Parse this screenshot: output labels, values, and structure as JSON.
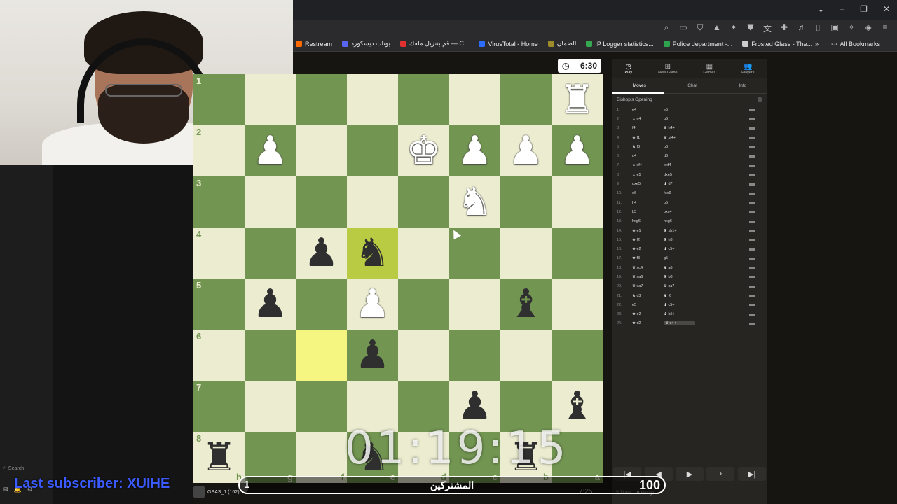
{
  "bookmarks": [
    {
      "label": "Restream",
      "color": "#ff6a00"
    },
    {
      "label": "بوتات ديسكورد",
      "color": "#5865f2"
    },
    {
      "label": "قم بتنزيل ملفك — C...",
      "color": "#e03030"
    },
    {
      "label": "VirusTotal - Home",
      "color": "#2c6cff"
    },
    {
      "label": "الضمان",
      "color": "#9e8c2a"
    },
    {
      "label": "IP Logger statistics...",
      "color": "#36a852"
    },
    {
      "label": "Police department -...",
      "color": "#2ea44f"
    },
    {
      "label": "Frosted Glass - The...",
      "color": "#cccccc"
    }
  ],
  "all_bookmarks": "All Bookmarks",
  "clock_top": "6:30",
  "clock_bottom": "7:25",
  "board": {
    "ranks": [
      "1",
      "2",
      "3",
      "4",
      "5",
      "6",
      "7",
      "8"
    ],
    "files": [
      "h",
      "g",
      "f",
      "e",
      "d",
      "c",
      "b",
      "a"
    ],
    "squares": [
      [
        "",
        "",
        "",
        "",
        "",
        "",
        "",
        "R"
      ],
      [
        "",
        "P",
        "",
        "",
        "K",
        "P",
        "P",
        "P"
      ],
      [
        "",
        "",
        "",
        "",
        "",
        "N",
        "",
        ""
      ],
      [
        "",
        "",
        "p",
        "n",
        "",
        "",
        "",
        ""
      ],
      [
        "",
        "p",
        "",
        "P",
        "",
        "",
        "b",
        ""
      ],
      [
        "",
        "",
        "",
        "p",
        "",
        "",
        "",
        ""
      ],
      [
        "",
        "",
        "",
        "",
        "",
        "p",
        "",
        "b"
      ],
      [
        "r",
        "",
        "",
        "n",
        "",
        "",
        "r",
        ""
      ]
    ]
  },
  "panel": {
    "tabs": [
      {
        "label": "Play",
        "icon": "clock-icon"
      },
      {
        "label": "New Game",
        "icon": "plus-icon"
      },
      {
        "label": "Games",
        "icon": "grid-icon"
      },
      {
        "label": "Players",
        "icon": "people-icon"
      }
    ],
    "subtabs": [
      "Moves",
      "Chat",
      "Info"
    ],
    "opening": "Bishop's Opening",
    "moves": [
      {
        "n": "1.",
        "w": "e4",
        "b": "e5"
      },
      {
        "n": "2.",
        "w": "♝ c4",
        "b": "g6"
      },
      {
        "n": "3.",
        "w": "f4",
        "b": "♛ h4+"
      },
      {
        "n": "4.",
        "w": "♚ f1",
        "b": "♛ xf4+"
      },
      {
        "n": "5.",
        "w": "♞ f3",
        "b": "b6"
      },
      {
        "n": "6.",
        "w": "d4",
        "b": "d6"
      },
      {
        "n": "7.",
        "w": "♝ xf4",
        "b": "exf4"
      },
      {
        "n": "8.",
        "w": "♝ e5",
        "b": "dxe5"
      },
      {
        "n": "9.",
        "w": "dxe5",
        "b": "♝ d7"
      },
      {
        "n": "10.",
        "w": "e6",
        "b": "fxe6"
      },
      {
        "n": "11.",
        "w": "h4",
        "b": "b5"
      },
      {
        "n": "12.",
        "w": "b5",
        "b": "bxc4"
      },
      {
        "n": "13.",
        "w": "hxg6",
        "b": "hxg6"
      },
      {
        "n": "14.",
        "w": "♚ e1",
        "b": "♜ xh1+"
      },
      {
        "n": "15.",
        "w": "♚ f2",
        "b": "♜ h8"
      },
      {
        "n": "16.",
        "w": "♚ e2",
        "b": "♝ c5+"
      },
      {
        "n": "17.",
        "w": "♚ f3",
        "b": "g5"
      },
      {
        "n": "18.",
        "w": "♛ xc4",
        "b": "♞ a6"
      },
      {
        "n": "19.",
        "w": "♛ xa6",
        "b": "♜ b8"
      },
      {
        "n": "20.",
        "w": "♛ xa7",
        "b": "♛ xa7"
      },
      {
        "n": "21.",
        "w": "♞ c3",
        "b": "♞ f6"
      },
      {
        "n": "22.",
        "w": "e5",
        "b": "♝ c5+"
      },
      {
        "n": "23.",
        "w": "♚ e2",
        "b": "♝ b5+"
      },
      {
        "n": "24.",
        "w": "♚ d2",
        "b": "♛ e4+"
      }
    ],
    "draw": "Draw",
    "resign": "Resign"
  },
  "overlay": {
    "timer": "01:19:15",
    "subscriber": "Last subscriber: XUIHE",
    "goal_label": "المشتركين",
    "goal_current": "1",
    "goal_target": "100",
    "goal_progress": 0.01
  },
  "left_footer": {
    "search": "Search"
  },
  "player": {
    "name": "GSAS_1 (162)"
  }
}
